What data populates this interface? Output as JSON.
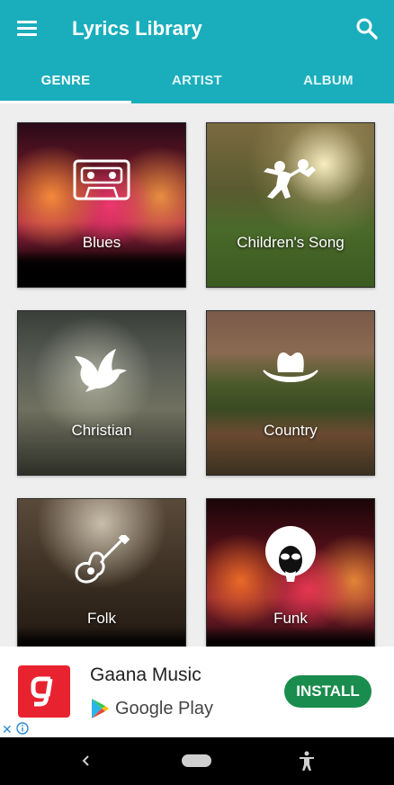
{
  "app": {
    "title": "Lyrics Library",
    "accent_color": "#1aaebc",
    "menu_icon": "hamburger-menu-icon",
    "search_icon": "search-icon"
  },
  "tabs": [
    {
      "label": "GENRE",
      "active": true
    },
    {
      "label": "ARTIST",
      "active": false
    },
    {
      "label": "ALBUM",
      "active": false
    }
  ],
  "genres": [
    {
      "label": "Blues",
      "icon": "cassette-tape-icon"
    },
    {
      "label": "Children's Song",
      "icon": "children-playing-icon"
    },
    {
      "label": "Christian",
      "icon": "dove-icon"
    },
    {
      "label": "Country",
      "icon": "cowboy-hat-icon"
    },
    {
      "label": "Folk",
      "icon": "guitar-icon"
    },
    {
      "label": "Funk",
      "icon": "afro-sunglasses-icon"
    }
  ],
  "ad": {
    "app_name": "Gaana Music",
    "store": "Google Play",
    "cta": "INSTALL",
    "logo_color": "#e8232f",
    "cta_color": "#1a8c4d",
    "close_glyph": "✕"
  },
  "navbar": {
    "back_icon": "back-icon",
    "home_icon": "home-pill-icon",
    "accessibility_icon": "accessibility-icon"
  }
}
